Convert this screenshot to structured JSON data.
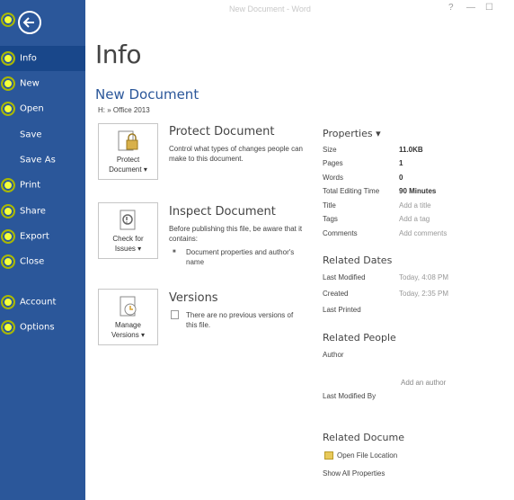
{
  "window": {
    "title": "New Document - Word",
    "help_label": "?",
    "minimize_label": "—",
    "maximize_label": "☐"
  },
  "sidebar": {
    "items": [
      {
        "label": "Info",
        "active": true
      },
      {
        "label": "New"
      },
      {
        "label": "Open"
      },
      {
        "label": "Save"
      },
      {
        "label": "Save As"
      },
      {
        "label": "Print"
      },
      {
        "label": "Share"
      },
      {
        "label": "Export"
      },
      {
        "label": "Close"
      },
      {
        "label": "Account"
      },
      {
        "label": "Options"
      }
    ]
  },
  "page": {
    "title": "Info",
    "doc_title": "New Document",
    "doc_path": "H: » Office 2013"
  },
  "sections": {
    "protect": {
      "button_label_1": "Protect",
      "button_label_2": "Document ▾",
      "title": "Protect Document",
      "desc": "Control what types of changes people can make to this document."
    },
    "inspect": {
      "button_label_1": "Check for",
      "button_label_2": "Issues ▾",
      "title": "Inspect Document",
      "desc": "Before publishing this file, be aware that it contains:",
      "bullet": "Document properties and author's name"
    },
    "versions": {
      "button_label_1": "Manage",
      "button_label_2": "Versions ▾",
      "title": "Versions",
      "desc": "There are no previous versions of this file."
    }
  },
  "properties": {
    "heading": "Properties ▾",
    "rows": [
      {
        "name": "Size",
        "value": "11.0KB"
      },
      {
        "name": "Pages",
        "value": "1"
      },
      {
        "name": "Words",
        "value": "0"
      },
      {
        "name": "Total Editing Time",
        "value": "90 Minutes"
      },
      {
        "name": "Title",
        "value": "Add a title"
      },
      {
        "name": "Tags",
        "value": "Add a tag"
      },
      {
        "name": "Comments",
        "value": "Add comments"
      }
    ],
    "related_dates": {
      "heading": "Related Dates",
      "rows": [
        {
          "name": "Last Modified",
          "value": "Today, 4:08 PM"
        },
        {
          "name": "Created",
          "value": "Today, 2:35 PM"
        },
        {
          "name": "Last Printed",
          "value": ""
        }
      ]
    },
    "related_people": {
      "heading": "Related People",
      "author_label": "Author",
      "add_author": "Add an author",
      "last_modified_by": "Last Modified By"
    },
    "related_documents": {
      "heading": "Related Docume",
      "open_location": "Open File Location",
      "show_all": "Show All Properties"
    }
  },
  "colors": {
    "sidebar": "#2b579a",
    "active_item": "#19478a",
    "accent": "#2b579a",
    "bullet": "#eef200"
  }
}
